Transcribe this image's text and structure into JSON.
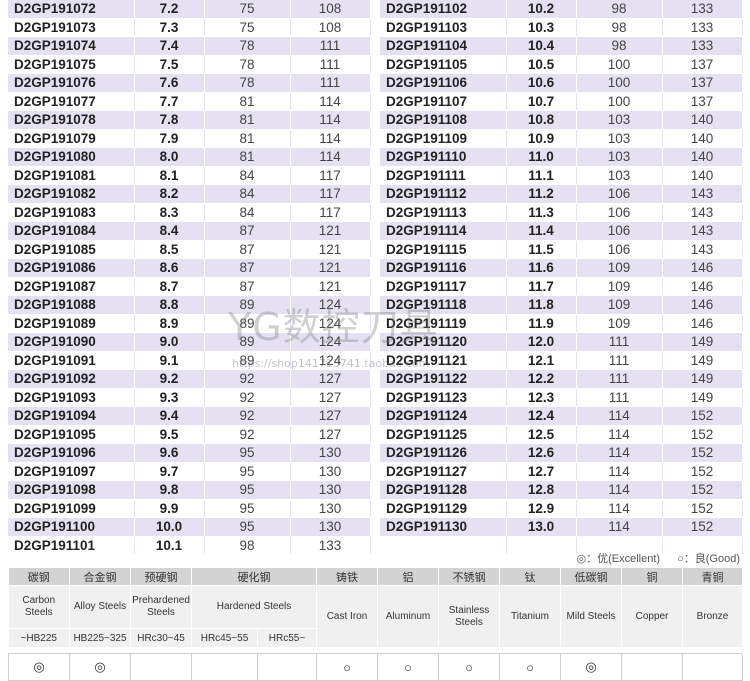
{
  "left_rows": [
    [
      "D2GP191072",
      "7.2",
      "75",
      "108"
    ],
    [
      "D2GP191073",
      "7.3",
      "75",
      "108"
    ],
    [
      "D2GP191074",
      "7.4",
      "78",
      "111"
    ],
    [
      "D2GP191075",
      "7.5",
      "78",
      "111"
    ],
    [
      "D2GP191076",
      "7.6",
      "78",
      "111"
    ],
    [
      "D2GP191077",
      "7.7",
      "81",
      "114"
    ],
    [
      "D2GP191078",
      "7.8",
      "81",
      "114"
    ],
    [
      "D2GP191079",
      "7.9",
      "81",
      "114"
    ],
    [
      "D2GP191080",
      "8.0",
      "81",
      "114"
    ],
    [
      "D2GP191081",
      "8.1",
      "84",
      "117"
    ],
    [
      "D2GP191082",
      "8.2",
      "84",
      "117"
    ],
    [
      "D2GP191083",
      "8.3",
      "84",
      "117"
    ],
    [
      "D2GP191084",
      "8.4",
      "87",
      "121"
    ],
    [
      "D2GP191085",
      "8.5",
      "87",
      "121"
    ],
    [
      "D2GP191086",
      "8.6",
      "87",
      "121"
    ],
    [
      "D2GP191087",
      "8.7",
      "87",
      "121"
    ],
    [
      "D2GP191088",
      "8.8",
      "89",
      "124"
    ],
    [
      "D2GP191089",
      "8.9",
      "89",
      "124"
    ],
    [
      "D2GP191090",
      "9.0",
      "89",
      "124"
    ],
    [
      "D2GP191091",
      "9.1",
      "89",
      "124"
    ],
    [
      "D2GP191092",
      "9.2",
      "92",
      "127"
    ],
    [
      "D2GP191093",
      "9.3",
      "92",
      "127"
    ],
    [
      "D2GP191094",
      "9.4",
      "92",
      "127"
    ],
    [
      "D2GP191095",
      "9.5",
      "92",
      "127"
    ],
    [
      "D2GP191096",
      "9.6",
      "95",
      "130"
    ],
    [
      "D2GP191097",
      "9.7",
      "95",
      "130"
    ],
    [
      "D2GP191098",
      "9.8",
      "95",
      "130"
    ],
    [
      "D2GP191099",
      "9.9",
      "95",
      "130"
    ],
    [
      "D2GP191100",
      "10.0",
      "95",
      "130"
    ],
    [
      "D2GP191101",
      "10.1",
      "98",
      "133"
    ]
  ],
  "right_rows": [
    [
      "D2GP191102",
      "10.2",
      "98",
      "133"
    ],
    [
      "D2GP191103",
      "10.3",
      "98",
      "133"
    ],
    [
      "D2GP191104",
      "10.4",
      "98",
      "133"
    ],
    [
      "D2GP191105",
      "10.5",
      "100",
      "137"
    ],
    [
      "D2GP191106",
      "10.6",
      "100",
      "137"
    ],
    [
      "D2GP191107",
      "10.7",
      "100",
      "137"
    ],
    [
      "D2GP191108",
      "10.8",
      "103",
      "140"
    ],
    [
      "D2GP191109",
      "10.9",
      "103",
      "140"
    ],
    [
      "D2GP191110",
      "11.0",
      "103",
      "140"
    ],
    [
      "D2GP191111",
      "11.1",
      "103",
      "140"
    ],
    [
      "D2GP191112",
      "11.2",
      "106",
      "143"
    ],
    [
      "D2GP191113",
      "11.3",
      "106",
      "143"
    ],
    [
      "D2GP191114",
      "11.4",
      "106",
      "143"
    ],
    [
      "D2GP191115",
      "11.5",
      "106",
      "143"
    ],
    [
      "D2GP191116",
      "11.6",
      "109",
      "146"
    ],
    [
      "D2GP191117",
      "11.7",
      "109",
      "146"
    ],
    [
      "D2GP191118",
      "11.8",
      "109",
      "146"
    ],
    [
      "D2GP191119",
      "11.9",
      "109",
      "146"
    ],
    [
      "D2GP191120",
      "12.0",
      "111",
      "149"
    ],
    [
      "D2GP191121",
      "12.1",
      "111",
      "149"
    ],
    [
      "D2GP191122",
      "12.2",
      "111",
      "149"
    ],
    [
      "D2GP191123",
      "12.3",
      "111",
      "149"
    ],
    [
      "D2GP191124",
      "12.4",
      "114",
      "152"
    ],
    [
      "D2GP191125",
      "12.5",
      "114",
      "152"
    ],
    [
      "D2GP191126",
      "12.6",
      "114",
      "152"
    ],
    [
      "D2GP191127",
      "12.7",
      "114",
      "152"
    ],
    [
      "D2GP191128",
      "12.8",
      "114",
      "152"
    ],
    [
      "D2GP191129",
      "12.9",
      "114",
      "152"
    ],
    [
      "D2GP191130",
      "13.0",
      "114",
      "152"
    ],
    [
      "",
      "",
      "",
      ""
    ]
  ],
  "legend": {
    "excellent": "◎：优(Excellent)",
    "good": "○：良(Good)"
  },
  "materials": {
    "zh": [
      "碳钢",
      "合金钢",
      "预硬钢",
      "硬化钢",
      "铸铁",
      "铝",
      "不锈钢",
      "钛",
      "低碳钢",
      "铜",
      "青铜"
    ],
    "en": [
      "Carbon Steels",
      "Alloy Steels",
      "Prehardened Steels",
      "Hardened Steels",
      "Cast Iron",
      "Aluminum",
      "Stainless Steels",
      "Titanium",
      "Mild Steels",
      "Copper",
      "Bronze"
    ],
    "hardness": [
      "~HB225",
      "HB225~325",
      "HRc30~45",
      "HRc45~55",
      "HRc55~"
    ],
    "marks": [
      "◎",
      "◎",
      "",
      "",
      "",
      "○",
      "○",
      "○",
      "○",
      "◎",
      "",
      "",
      ""
    ]
  },
  "watermark": {
    "title": "YG数控刀具",
    "url": "https://shop141713741.taobao.com"
  }
}
